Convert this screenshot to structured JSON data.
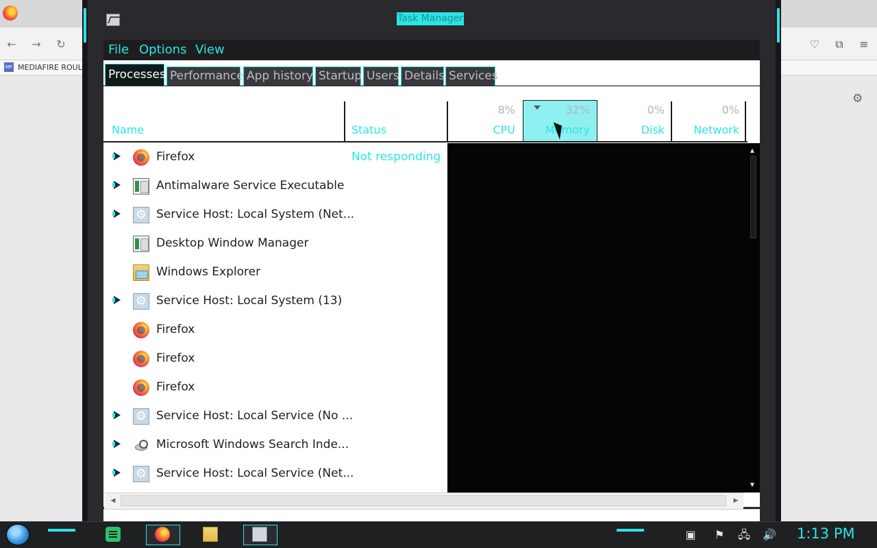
{
  "window": {
    "title": "Task Manager"
  },
  "background_browser": {
    "bookmark_label": "MEDIAFIRE ROULET"
  },
  "menu": [
    "File",
    "Options",
    "View"
  ],
  "tabs": [
    {
      "label": "Processes",
      "active": true
    },
    {
      "label": "Performance",
      "active": false
    },
    {
      "label": "App history",
      "active": false
    },
    {
      "label": "Startup",
      "active": false
    },
    {
      "label": "Users",
      "active": false
    },
    {
      "label": "Details",
      "active": false
    },
    {
      "label": "Services",
      "active": false
    }
  ],
  "columns": {
    "name": {
      "label": "Name"
    },
    "status": {
      "label": "Status"
    },
    "cpu": {
      "label": "CPU",
      "percent": "8%"
    },
    "memory": {
      "label": "Memory",
      "percent": "32%",
      "sorted": "descending"
    },
    "disk": {
      "label": "Disk",
      "percent": "0%"
    },
    "network": {
      "label": "Network",
      "percent": "0%"
    }
  },
  "processes": [
    {
      "name": "Firefox",
      "status": "Not responding",
      "expandable": true,
      "icon": "firefox-icon"
    },
    {
      "name": "Antimalware Service Executable",
      "status": "",
      "expandable": true,
      "icon": "window-app-icon"
    },
    {
      "name": "Service Host: Local System (Net...",
      "status": "",
      "expandable": true,
      "icon": "gear-icon"
    },
    {
      "name": "Desktop Window Manager",
      "status": "",
      "expandable": false,
      "icon": "window-app-icon"
    },
    {
      "name": "Windows Explorer",
      "status": "",
      "expandable": false,
      "icon": "folder-icon"
    },
    {
      "name": "Service Host: Local System (13)",
      "status": "",
      "expandable": true,
      "icon": "gear-icon"
    },
    {
      "name": "Firefox",
      "status": "",
      "expandable": false,
      "icon": "firefox-icon"
    },
    {
      "name": "Firefox",
      "status": "",
      "expandable": false,
      "icon": "firefox-icon"
    },
    {
      "name": "Firefox",
      "status": "",
      "expandable": false,
      "icon": "firefox-icon"
    },
    {
      "name": "Service Host: Local Service (No ...",
      "status": "",
      "expandable": true,
      "icon": "gear-icon"
    },
    {
      "name": "Microsoft Windows Search Inde...",
      "status": "",
      "expandable": true,
      "icon": "search-indexer-icon"
    },
    {
      "name": "Service Host: Local Service (Net...",
      "status": "",
      "expandable": true,
      "icon": "gear-icon"
    }
  ],
  "taskbar": {
    "clock": "1:13 PM",
    "apps": [
      "notes-app-icon",
      "firefox-icon",
      "file-explorer-icon",
      "task-manager-icon"
    ],
    "tray": [
      "action-center-icon",
      "flag-icon",
      "network-icon",
      "volume-icon"
    ]
  },
  "colors": {
    "accent": "#2ce5e5",
    "frame": "#2a2a2e",
    "data_area": "#050505",
    "sorted_header": "#8ef0f0"
  }
}
